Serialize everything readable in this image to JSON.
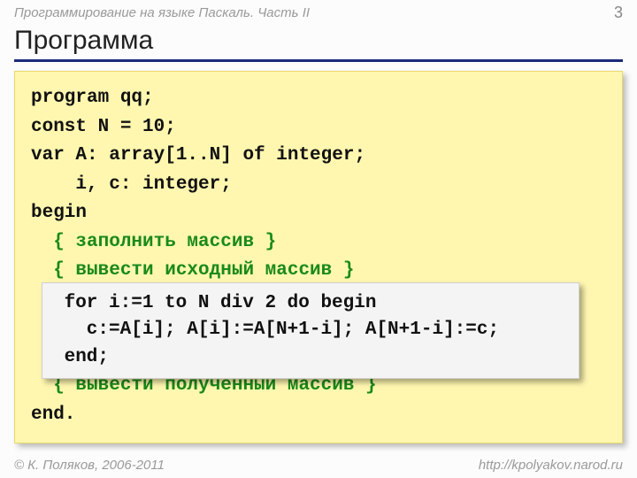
{
  "header": {
    "course": "Программирование на языке Паскаль. Часть II",
    "page": "3"
  },
  "title": "Программа",
  "code": {
    "l1": "program qq;",
    "l2": "const N = 10;",
    "l3": "var A: array[1..N] of integer;",
    "l4": "    i, c: integer;",
    "l5": "begin",
    "l6": "  { заполнить массив }",
    "l7": "  { вывести исходный массив }",
    "gap1": " ",
    "gap2": " ",
    "gap3": " ",
    "l8": "  { вывести полученный массив }",
    "l9": "end."
  },
  "inset": {
    "l1": " for i:=1 to N div 2 do begin",
    "l2": "   c:=A[i]; A[i]:=A[N+1-i]; A[N+1-i]:=c;",
    "l3": " end;"
  },
  "footer": {
    "copyright": "© К. Поляков, 2006-2011",
    "url": "http://kpolyakov.narod.ru"
  }
}
